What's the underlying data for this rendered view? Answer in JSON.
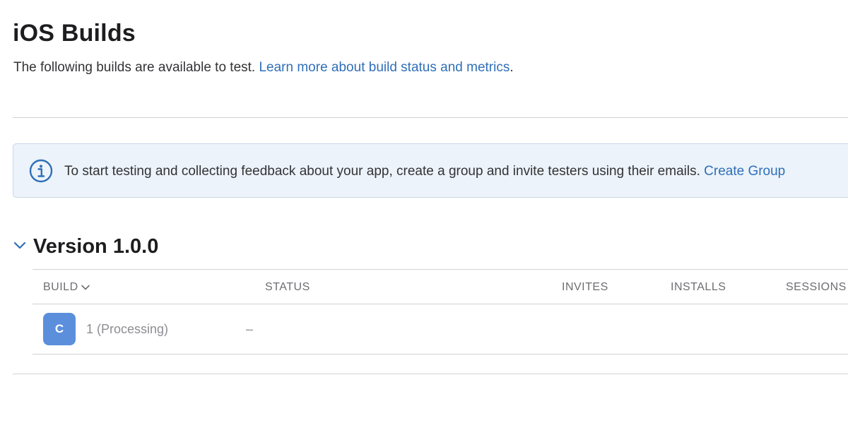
{
  "header": {
    "title": "iOS Builds",
    "subtitle_prefix": "The following builds are available to test. ",
    "subtitle_link": "Learn more about build status and metrics",
    "subtitle_suffix": "."
  },
  "banner": {
    "icon": "info-circle-icon",
    "text": "To start testing and collecting feedback about your app, create a group and invite testers using their emails. ",
    "link": "Create Group"
  },
  "version": {
    "title": "Version 1.0.0",
    "expanded": true,
    "columns": {
      "build": "BUILD",
      "status": "STATUS",
      "invites": "INVITES",
      "installs": "INSTALLS",
      "sessions": "SESSIONS"
    },
    "rows": [
      {
        "badge_letter": "C",
        "build": "1 (Processing)",
        "status": "–"
      }
    ]
  },
  "colors": {
    "accent_link": "#2f6fb8",
    "banner_bg": "#ecf3fa",
    "badge_bg": "#5b8fdc"
  }
}
